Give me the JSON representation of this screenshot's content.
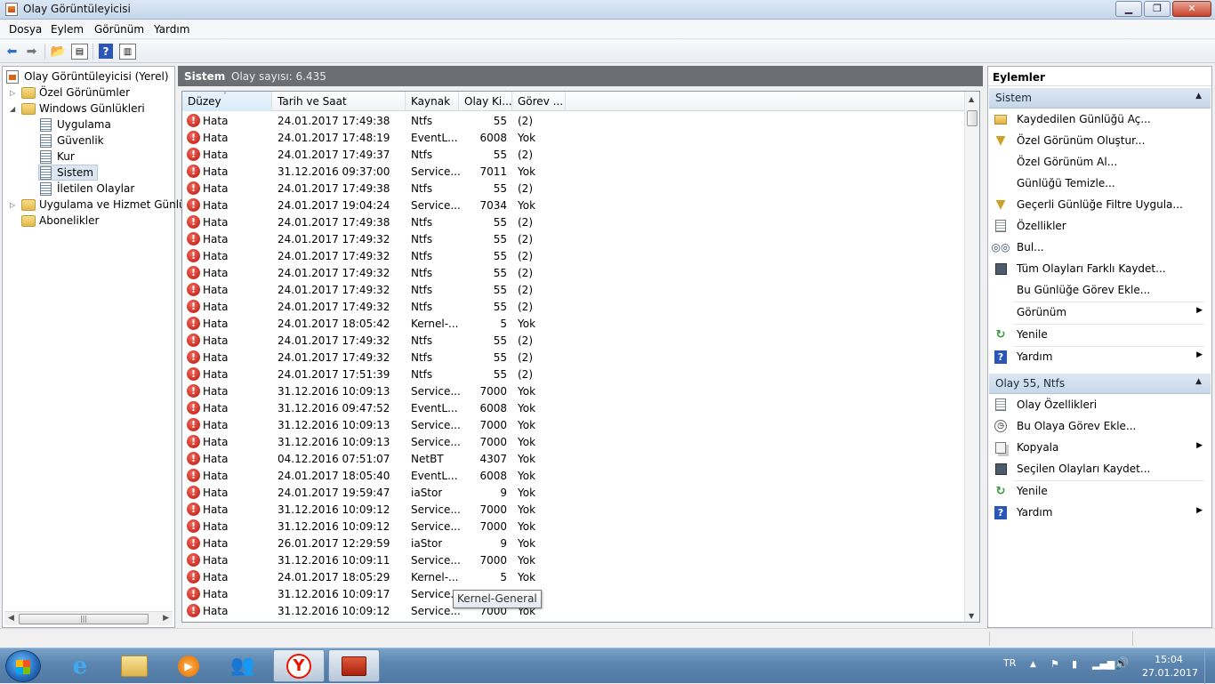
{
  "window": {
    "title": "Olay Görüntüleyicisi"
  },
  "menu": [
    "Dosya",
    "Eylem",
    "Görünüm",
    "Yardım"
  ],
  "tree": {
    "root": "Olay Görüntüleyicisi (Yerel)",
    "custom_views": "Özel Görünümler",
    "windows_logs": "Windows Günlükleri",
    "application": "Uygulama",
    "security": "Güvenlik",
    "setup": "Kur",
    "system": "Sistem",
    "forwarded": "İletilen Olaylar",
    "app_service_logs": "Uygulama ve Hizmet Günlükleri",
    "subscriptions": "Abonelikler"
  },
  "log_header": {
    "name": "Sistem",
    "count": "Olay sayısı: 6.435"
  },
  "columns": [
    "Düzey",
    "Tarih ve Saat",
    "Kaynak",
    "Olay Ki...",
    "Görev ..."
  ],
  "events": [
    {
      "level": "Hata",
      "date": "24.01.2017 17:49:38",
      "source": "Ntfs",
      "id": "55",
      "task": "(2)"
    },
    {
      "level": "Hata",
      "date": "24.01.2017 17:48:19",
      "source": "EventL...",
      "id": "6008",
      "task": "Yok"
    },
    {
      "level": "Hata",
      "date": "24.01.2017 17:49:37",
      "source": "Ntfs",
      "id": "55",
      "task": "(2)"
    },
    {
      "level": "Hata",
      "date": "31.12.2016 09:37:00",
      "source": "Service...",
      "id": "7011",
      "task": "Yok"
    },
    {
      "level": "Hata",
      "date": "24.01.2017 17:49:38",
      "source": "Ntfs",
      "id": "55",
      "task": "(2)"
    },
    {
      "level": "Hata",
      "date": "24.01.2017 19:04:24",
      "source": "Service...",
      "id": "7034",
      "task": "Yok"
    },
    {
      "level": "Hata",
      "date": "24.01.2017 17:49:38",
      "source": "Ntfs",
      "id": "55",
      "task": "(2)"
    },
    {
      "level": "Hata",
      "date": "24.01.2017 17:49:32",
      "source": "Ntfs",
      "id": "55",
      "task": "(2)"
    },
    {
      "level": "Hata",
      "date": "24.01.2017 17:49:32",
      "source": "Ntfs",
      "id": "55",
      "task": "(2)"
    },
    {
      "level": "Hata",
      "date": "24.01.2017 17:49:32",
      "source": "Ntfs",
      "id": "55",
      "task": "(2)"
    },
    {
      "level": "Hata",
      "date": "24.01.2017 17:49:32",
      "source": "Ntfs",
      "id": "55",
      "task": "(2)"
    },
    {
      "level": "Hata",
      "date": "24.01.2017 17:49:32",
      "source": "Ntfs",
      "id": "55",
      "task": "(2)"
    },
    {
      "level": "Hata",
      "date": "24.01.2017 18:05:42",
      "source": "Kernel-...",
      "id": "5",
      "task": "Yok"
    },
    {
      "level": "Hata",
      "date": "24.01.2017 17:49:32",
      "source": "Ntfs",
      "id": "55",
      "task": "(2)"
    },
    {
      "level": "Hata",
      "date": "24.01.2017 17:49:32",
      "source": "Ntfs",
      "id": "55",
      "task": "(2)"
    },
    {
      "level": "Hata",
      "date": "24.01.2017 17:51:39",
      "source": "Ntfs",
      "id": "55",
      "task": "(2)"
    },
    {
      "level": "Hata",
      "date": "31.12.2016 10:09:13",
      "source": "Service...",
      "id": "7000",
      "task": "Yok"
    },
    {
      "level": "Hata",
      "date": "31.12.2016 09:47:52",
      "source": "EventL...",
      "id": "6008",
      "task": "Yok"
    },
    {
      "level": "Hata",
      "date": "31.12.2016 10:09:13",
      "source": "Service...",
      "id": "7000",
      "task": "Yok"
    },
    {
      "level": "Hata",
      "date": "31.12.2016 10:09:13",
      "source": "Service...",
      "id": "7000",
      "task": "Yok"
    },
    {
      "level": "Hata",
      "date": "04.12.2016 07:51:07",
      "source": "NetBT",
      "id": "4307",
      "task": "Yok"
    },
    {
      "level": "Hata",
      "date": "24.01.2017 18:05:40",
      "source": "EventL...",
      "id": "6008",
      "task": "Yok"
    },
    {
      "level": "Hata",
      "date": "24.01.2017 19:59:47",
      "source": "iaStor",
      "id": "9",
      "task": "Yok"
    },
    {
      "level": "Hata",
      "date": "31.12.2016 10:09:12",
      "source": "Service...",
      "id": "7000",
      "task": "Yok"
    },
    {
      "level": "Hata",
      "date": "31.12.2016 10:09:12",
      "source": "Service...",
      "id": "7000",
      "task": "Yok"
    },
    {
      "level": "Hata",
      "date": "26.01.2017 12:29:59",
      "source": "iaStor",
      "id": "9",
      "task": "Yok"
    },
    {
      "level": "Hata",
      "date": "31.12.2016 10:09:11",
      "source": "Service...",
      "id": "7000",
      "task": "Yok"
    },
    {
      "level": "Hata",
      "date": "24.01.2017 18:05:29",
      "source": "Kernel-...",
      "id": "5",
      "task": "Yok"
    },
    {
      "level": "Hata",
      "date": "31.12.2016 10:09:17",
      "source": "Service...",
      "id": "",
      "task": ""
    },
    {
      "level": "Hata",
      "date": "31.12.2016 10:09:12",
      "source": "Service...",
      "id": "7000",
      "task": "Yok"
    }
  ],
  "tooltip": "Kernel-General",
  "actions": {
    "title": "Eylemler",
    "section1": "Sistem",
    "items1": [
      {
        "label": "Kaydedilen Günlüğü Aç...",
        "icon": "folder-open-icon",
        "sub": false
      },
      {
        "label": "Özel Görünüm Oluştur...",
        "icon": "filter-icon",
        "sub": false
      },
      {
        "label": "Özel Görünüm Al...",
        "icon": "",
        "sub": false
      },
      {
        "label": "Günlüğü Temizle...",
        "icon": "",
        "sub": false
      },
      {
        "label": "Geçerli Günlüğe Filtre Uygula...",
        "icon": "filter-icon",
        "sub": false
      },
      {
        "label": "Özellikler",
        "icon": "properties-icon",
        "sub": false
      },
      {
        "label": "Bul...",
        "icon": "binoculars-icon",
        "sub": false
      },
      {
        "label": "Tüm Olayları Farklı Kaydet...",
        "icon": "save-icon",
        "sub": false
      },
      {
        "label": "Bu Günlüğe Görev Ekle...",
        "icon": "",
        "sub": false
      },
      {
        "label": "Görünüm",
        "icon": "",
        "sub": true
      },
      {
        "label": "Yenile",
        "icon": "refresh-icon",
        "sub": false
      },
      {
        "label": "Yardım",
        "icon": "help-icon",
        "sub": true
      }
    ],
    "section2": "Olay 55, Ntfs",
    "items2": [
      {
        "label": "Olay Özellikleri",
        "icon": "properties-icon",
        "sub": false
      },
      {
        "label": "Bu Olaya Görev Ekle...",
        "icon": "task-icon",
        "sub": false
      },
      {
        "label": "Kopyala",
        "icon": "copy-icon",
        "sub": true
      },
      {
        "label": "Seçilen Olayları Kaydet...",
        "icon": "save-icon",
        "sub": false
      },
      {
        "label": "Yenile",
        "icon": "refresh-icon",
        "sub": false
      },
      {
        "label": "Yardım",
        "icon": "help-icon",
        "sub": true
      }
    ]
  },
  "taskbar": {
    "lang": "TR",
    "time": "15:04",
    "date": "27.01.2017"
  }
}
